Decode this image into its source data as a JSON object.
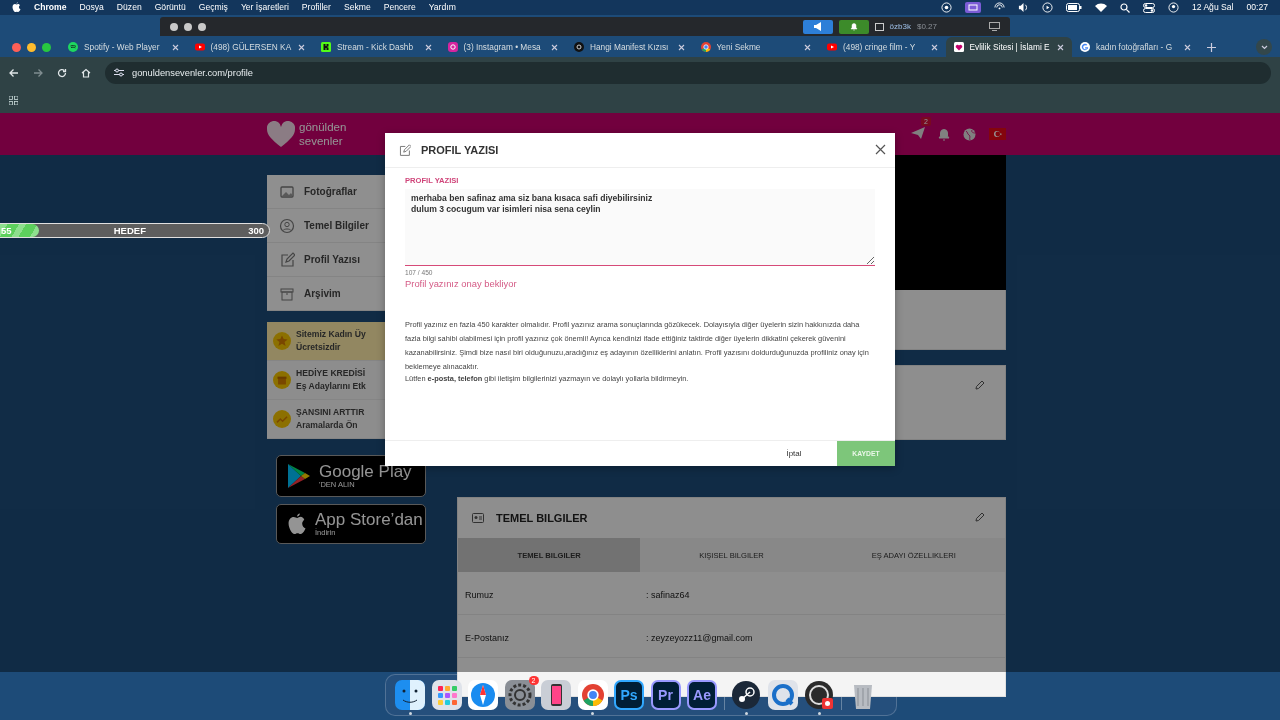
{
  "menu_bar": {
    "app": "Chrome",
    "items": [
      "Dosya",
      "Düzen",
      "Görüntü",
      "Geçmiş",
      "Yer İşaretleri",
      "Profiller",
      "Sekme",
      "Pencere",
      "Yardım"
    ],
    "date": "12 Ağu Sal",
    "time": "00:27"
  },
  "overlay_app": {
    "account": "özb3k",
    "balance": "$0.27"
  },
  "browser": {
    "tabs": [
      {
        "title": "Spotify - Web Player",
        "kind": "spotify",
        "selected": false
      },
      {
        "title": "(498) GÜLERSEN KA",
        "kind": "youtube",
        "selected": false
      },
      {
        "title": "Stream - Kick Dashb",
        "kind": "kick",
        "selected": false
      },
      {
        "title": "(3) Instagram • Mesa",
        "kind": "instagram",
        "selected": false
      },
      {
        "title": "Hangi Manifest Kızısı",
        "kind": "threads",
        "selected": false
      },
      {
        "title": "Yeni Sekme",
        "kind": "chrome",
        "selected": false
      },
      {
        "title": "(498) cringe film - Y",
        "kind": "youtube",
        "selected": false
      },
      {
        "title": "Evlilik Sitesi | İslami E",
        "kind": "site",
        "selected": true
      },
      {
        "title": "kadın fotoğrafları - G",
        "kind": "google",
        "selected": false
      }
    ],
    "url": "gonuldensevenler.com/profile"
  },
  "site": {
    "logo": [
      "gönülden",
      "sevenler"
    ],
    "notification_badge": "2",
    "progress": {
      "start": "55",
      "label": "HEDEF",
      "goal": "300",
      "level": 0.18
    },
    "sidebar": {
      "items": [
        {
          "label": "Fotoğraflar"
        },
        {
          "label": "Temel Bilgiler"
        },
        {
          "label": "Profil Yazısı"
        },
        {
          "label": "Arşivim"
        }
      ],
      "promos": [
        {
          "lines": [
            "Sitemiz Kadın Üy",
            "Ücretsizdir"
          ],
          "highlighted": true
        },
        {
          "lines": [
            "HEDİYE KREDİSİ",
            "Eş Adaylarını Etk"
          ],
          "highlighted": false
        },
        {
          "lines": [
            "ŞANSINI ARTTIR",
            "Aramalarda Ön"
          ],
          "highlighted": false
        }
      ]
    },
    "store_badges": [
      {
        "kind": "google",
        "title": "Google Play",
        "subtitle": "'DEN ALIN"
      },
      {
        "kind": "apple",
        "title": "App Store’dan",
        "subtitle": "İndirin"
      }
    ],
    "basic_info": {
      "title": "TEMEL BILGILER",
      "tabs": [
        {
          "label": "TEMEL BILGILER",
          "selected": true
        },
        {
          "label": "KIŞISEL BILGILER",
          "selected": false
        },
        {
          "label": "EŞ ADAYI ÖZELLIKLERI",
          "selected": false
        }
      ],
      "rows": [
        {
          "label": "Rumuz",
          "value": ": safinaz64"
        },
        {
          "label": "E-Postanız",
          "value": ": zeyzeyozz11@gmail.com"
        }
      ]
    }
  },
  "modal": {
    "title": "PROFIL YAZISI",
    "field_label": "PROFIL YAZISI",
    "value": "merhaba ben safinaz ama siz bana kısaca safi diyebilirsiniz\ndulum 3 cocugum var isimleri nisa sena ceylin",
    "counter": "107 / 450",
    "status": "Profil yazınız onay bekliyor",
    "help": [
      "Profil yazınız en fazla 450 karakter olmalıdır. Profil yazınız arama sonuçlarında gözükecek. Dolayısıyla diğer üyelerin sizin hakkınızda daha fazla bilgi sahibi olabilmesi için profil yazınız çok önemli! Ayrıca kendinizi ifade ettiğiniz taktirde diğer üyelerin dikkatini çekerek güvenini kazanabilirsiniz. Şimdi bize nasıl biri olduğunuzu,aradığınız eş adayının özelliklerini anlatın. Profil yazısını doldurduğunuzda profiliniz onay için beklemeye alınacaktır.",
      "Lütfen **e-posta, telefon** gibi iletişim bilgilerinizi yazmayın ve dolaylı yollarla bildirmeyin."
    ],
    "cancel": "İptal",
    "save": "KAYDET"
  },
  "dock": [
    {
      "kind": "finder",
      "running": true
    },
    {
      "kind": "launchpad",
      "running": false
    },
    {
      "kind": "safari",
      "running": false
    },
    {
      "kind": "settings",
      "running": false,
      "badge": "2"
    },
    {
      "kind": "phone",
      "running": false
    },
    {
      "kind": "chrome",
      "running": true
    },
    {
      "kind": "letters",
      "label": "Ps",
      "color": "#31a8ff",
      "running": false
    },
    {
      "kind": "letters",
      "label": "Pr",
      "color": "#9999ff",
      "running": false
    },
    {
      "kind": "letters",
      "label": "Ae",
      "color": "#9999ff",
      "running": false
    },
    {
      "kind": "separator"
    },
    {
      "kind": "steam",
      "running": true
    },
    {
      "kind": "quicktime",
      "running": false
    },
    {
      "kind": "obs",
      "running": true
    },
    {
      "kind": "separator"
    },
    {
      "kind": "trash",
      "running": false
    }
  ]
}
